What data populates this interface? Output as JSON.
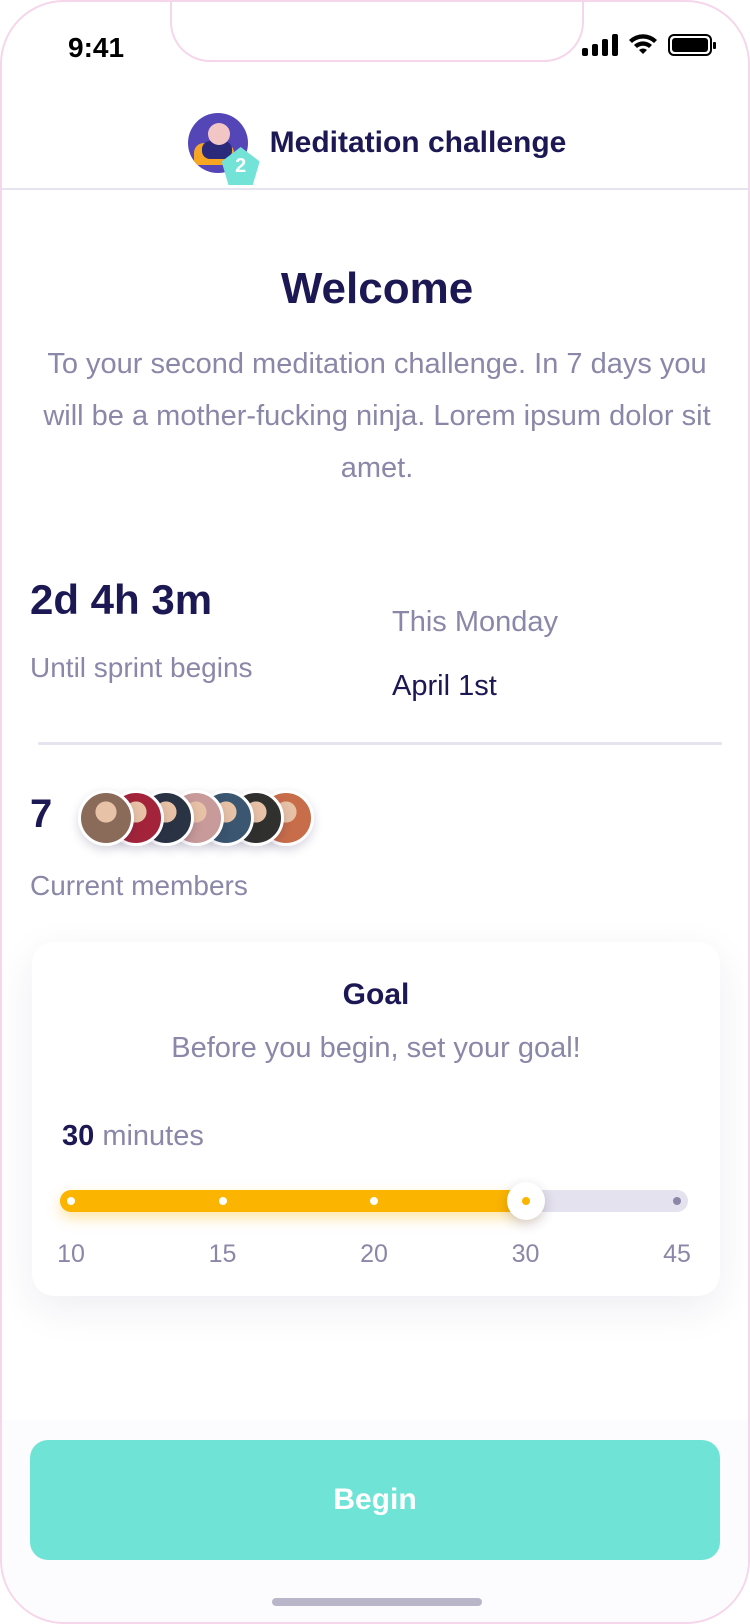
{
  "status_bar": {
    "time": "9:41"
  },
  "header": {
    "title": "Meditation challenge",
    "badge_number": "2"
  },
  "welcome": {
    "title": "Welcome",
    "text": "To your second meditation challenge. In 7 days you will be a mother-fucking ninja. Lorem ipsum dolor sit amet."
  },
  "countdown": {
    "value": "2d 4h 3m",
    "label": "Until sprint begins"
  },
  "start_date": {
    "label": "This Monday",
    "value": "April 1st"
  },
  "members": {
    "count": "7",
    "label": "Current members",
    "avatar_colors": [
      "#8a6a58",
      "#a3243a",
      "#2a3344",
      "#c89a9a",
      "#3a5670",
      "#30302e",
      "#c86d4a"
    ]
  },
  "goal": {
    "title": "Goal",
    "subtitle": "Before you begin, set your goal!",
    "value": "30",
    "unit": "minutes",
    "ticks": [
      "10",
      "15",
      "20",
      "30",
      "45"
    ],
    "selected_index": 3,
    "accent_color": "#fbb400"
  },
  "begin_button": {
    "label": "Begin",
    "color": "#6fe3d6"
  }
}
